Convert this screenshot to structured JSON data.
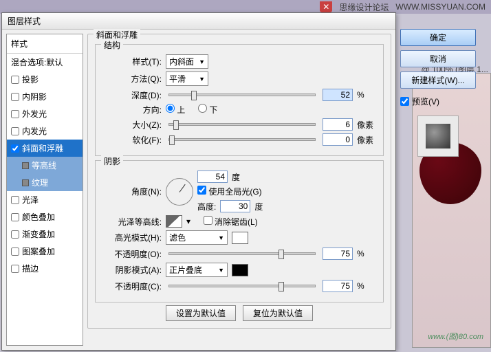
{
  "topbar": {
    "forum": "思缘设计论坛",
    "url": "WWW.MISSYUAN.COM"
  },
  "doc_title": "@ 100% (图层 1...",
  "watermark": "www.(图)80.com",
  "dialog": {
    "title": "图层样式",
    "left": {
      "header": "样式",
      "blend_default": "混合选项:默认",
      "items": {
        "drop_shadow": "投影",
        "inner_shadow": "内阴影",
        "outer_glow": "外发光",
        "inner_glow": "内发光",
        "bevel": "斜面和浮雕",
        "contour": "等高线",
        "texture": "纹理",
        "satin": "光泽",
        "color_overlay": "颜色叠加",
        "gradient_overlay": "渐变叠加",
        "pattern_overlay": "图案叠加",
        "stroke": "描边"
      }
    },
    "structure": {
      "title": "斜面和浮雕",
      "group": "结构",
      "style_label": "样式(T):",
      "style_value": "内斜面",
      "technique_label": "方法(Q):",
      "technique_value": "平滑",
      "depth_label": "深度(D):",
      "depth_value": "52",
      "depth_unit": "%",
      "direction_label": "方向:",
      "dir_up": "上",
      "dir_down": "下",
      "size_label": "大小(Z):",
      "size_value": "6",
      "size_unit": "像素",
      "soften_label": "软化(F):",
      "soften_value": "0",
      "soften_unit": "像素"
    },
    "shading": {
      "group": "阴影",
      "angle_label": "角度(N):",
      "angle_value": "54",
      "angle_unit": "度",
      "global_light": "使用全局光(G)",
      "altitude_label": "高度:",
      "altitude_value": "30",
      "altitude_unit": "度",
      "gloss_label": "光泽等高线:",
      "antialias": "消除锯齿(L)",
      "highlight_mode_label": "高光模式(H):",
      "highlight_mode_value": "滤色",
      "highlight_opacity_label": "不透明度(O):",
      "highlight_opacity_value": "75",
      "pct": "%",
      "shadow_mode_label": "阴影模式(A):",
      "shadow_mode_value": "正片叠底",
      "shadow_opacity_label": "不透明度(C):",
      "shadow_opacity_value": "75"
    },
    "buttons": {
      "make_default": "设置为默认值",
      "reset_default": "复位为默认值"
    }
  },
  "right": {
    "ok": "确定",
    "cancel": "取消",
    "new_style": "新建样式(W)...",
    "preview": "预览(V)"
  }
}
